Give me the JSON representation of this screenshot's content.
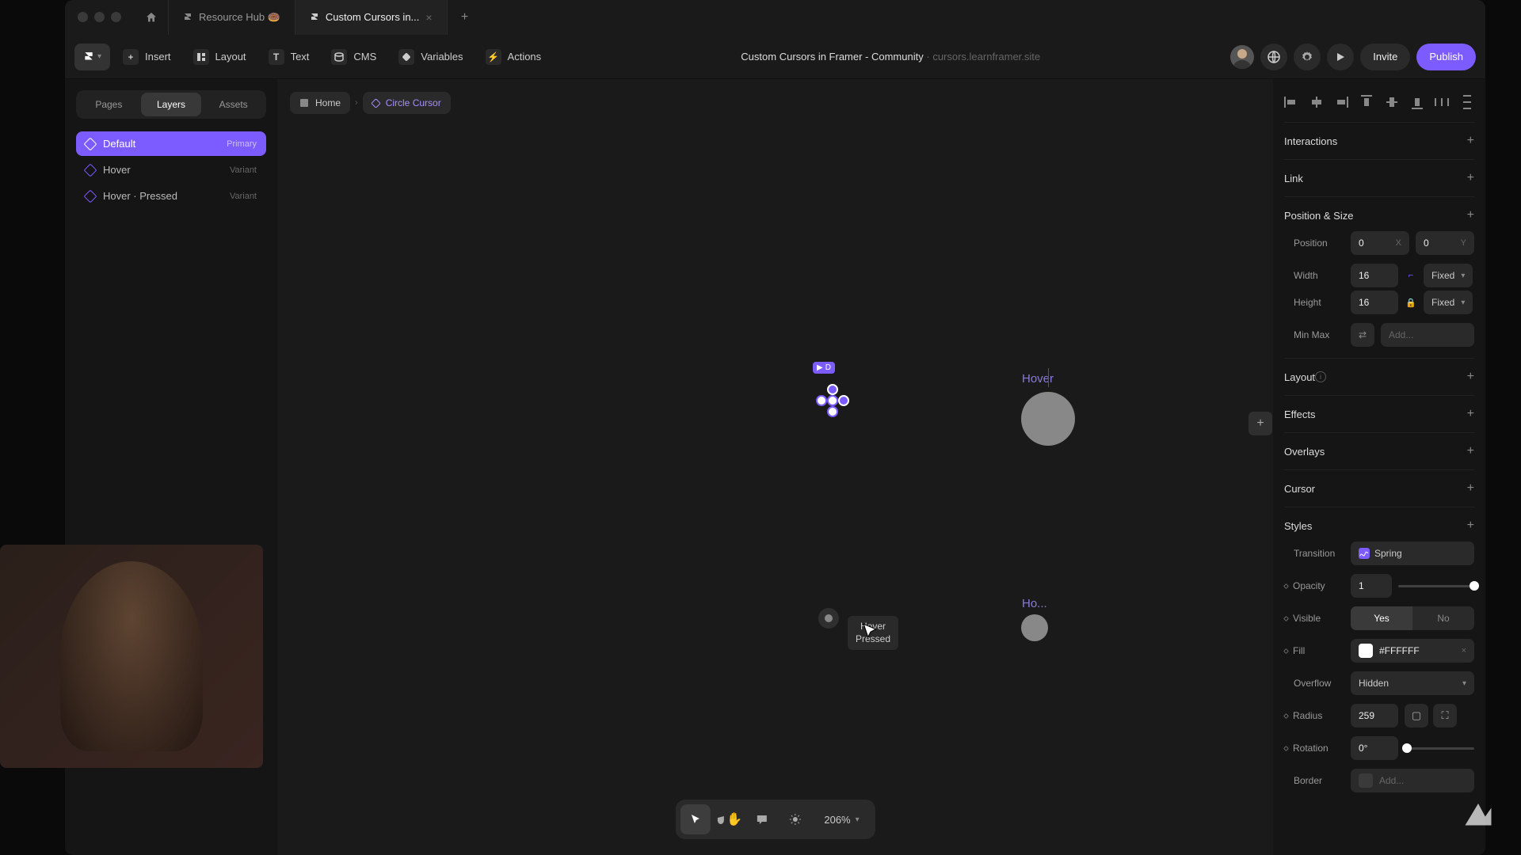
{
  "tabs": [
    {
      "label": "Resource Hub 🍩",
      "active": false
    },
    {
      "label": "Custom Cursors in...",
      "active": true
    }
  ],
  "toolbar": {
    "insert": "Insert",
    "layout": "Layout",
    "text": "Text",
    "cms": "CMS",
    "variables": "Variables",
    "actions": "Actions"
  },
  "title": {
    "main": "Custom Cursors in Framer - Community",
    "sub": "cursors.learnframer.site"
  },
  "topRight": {
    "invite": "Invite",
    "publish": "Publish"
  },
  "sidebar": {
    "tabs": {
      "pages": "Pages",
      "layers": "Layers",
      "assets": "Assets"
    },
    "items": [
      {
        "label": "Default",
        "badge": "Primary",
        "selected": true
      },
      {
        "label": "Hover",
        "badge": "Variant",
        "selected": false
      },
      {
        "label": "Hover · Pressed",
        "badge": "Variant",
        "selected": false
      }
    ]
  },
  "breadcrumbs": {
    "home": "Home",
    "current": "Circle Cursor"
  },
  "canvas": {
    "hover_label": "Hover",
    "hover2_label": "Ho...",
    "default_tag": "D",
    "tooltip": "Hover\nPressed"
  },
  "bottomBar": {
    "zoom": "206%"
  },
  "inspector": {
    "sections": {
      "interactions": "Interactions",
      "link": "Link",
      "positionSize": "Position & Size",
      "layout": "Layout",
      "effects": "Effects",
      "overlays": "Overlays",
      "cursor": "Cursor",
      "styles": "Styles"
    },
    "position": {
      "label": "Position",
      "x": "0",
      "y": "0"
    },
    "width": {
      "label": "Width",
      "value": "16",
      "mode": "Fixed"
    },
    "height": {
      "label": "Height",
      "value": "16",
      "mode": "Fixed"
    },
    "minmax": {
      "label": "Min Max",
      "placeholder": "Add..."
    },
    "transition": {
      "label": "Transition",
      "value": "Spring"
    },
    "opacity": {
      "label": "Opacity",
      "value": "1"
    },
    "visible": {
      "label": "Visible",
      "yes": "Yes",
      "no": "No"
    },
    "fill": {
      "label": "Fill",
      "value": "#FFFFFF"
    },
    "overflow": {
      "label": "Overflow",
      "value": "Hidden"
    },
    "radius": {
      "label": "Radius",
      "value": "259"
    },
    "rotation": {
      "label": "Rotation",
      "value": "0°"
    },
    "border": {
      "label": "Border",
      "placeholder": "Add..."
    }
  }
}
